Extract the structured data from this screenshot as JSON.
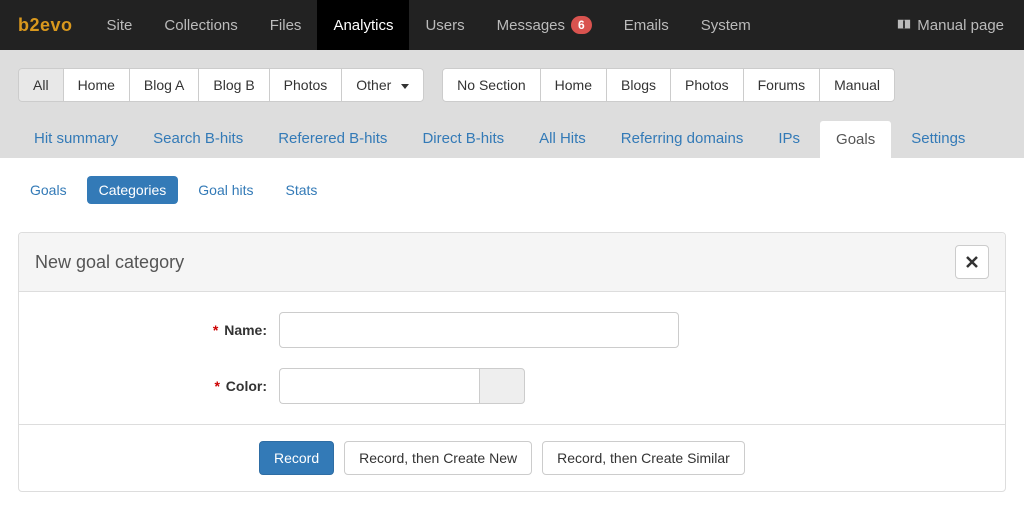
{
  "brand": "b2evo",
  "nav": {
    "site": "Site",
    "collections": "Collections",
    "files": "Files",
    "analytics": "Analytics",
    "users": "Users",
    "messages": "Messages",
    "messages_badge": "6",
    "emails": "Emails",
    "system": "System",
    "manual_page": "Manual page"
  },
  "collections_bar": {
    "all": "All",
    "home": "Home",
    "blog_a": "Blog A",
    "blog_b": "Blog B",
    "photos": "Photos",
    "other": "Other"
  },
  "sections_bar": {
    "no_section": "No Section",
    "home": "Home",
    "blogs": "Blogs",
    "photos": "Photos",
    "forums": "Forums",
    "manual": "Manual"
  },
  "tabs": {
    "hit_summary": "Hit summary",
    "search_bhits": "Search B-hits",
    "referred_bhits": "Referered B-hits",
    "direct_bhits": "Direct B-hits",
    "all_hits": "All Hits",
    "referring_domains": "Referring domains",
    "ips": "IPs",
    "goals": "Goals",
    "settings": "Settings"
  },
  "pills": {
    "goals": "Goals",
    "categories": "Categories",
    "goal_hits": "Goal hits",
    "stats": "Stats"
  },
  "panel": {
    "title": "New goal category",
    "name_label": "Name:",
    "color_label": "Color:",
    "name_value": "",
    "color_value": "",
    "required_mark": "*"
  },
  "actions": {
    "record": "Record",
    "record_new": "Record, then Create New",
    "record_similar": "Record, then Create Similar"
  }
}
